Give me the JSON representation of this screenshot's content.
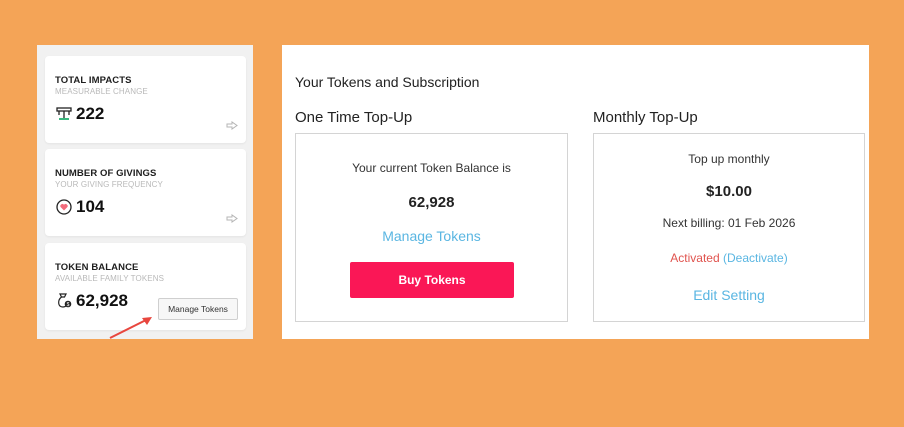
{
  "cards": {
    "impacts": {
      "title": "TOTAL IMPACTS",
      "subtitle": "MEASURABLE CHANGE",
      "value": "222",
      "icon": "impact-icon"
    },
    "givings": {
      "title": "NUMBER OF GIVINGS",
      "subtitle": "YOUR GIVING FREQUENCY",
      "value": "104",
      "icon": "heart-cycle-icon"
    },
    "tokens": {
      "title": "TOKEN BALANCE",
      "subtitle": "AVAILABLE FAMILY TOKENS",
      "value": "62,928",
      "icon": "money-bag-icon",
      "button_label": "Manage Tokens"
    }
  },
  "subscription": {
    "title": "Your Tokens and Subscription",
    "one_time": {
      "heading": "One Time Top-Up",
      "balance_label": "Your current Token Balance is",
      "balance": "62,928",
      "manage_link": "Manage Tokens",
      "buy_label": "Buy Tokens"
    },
    "monthly": {
      "heading": "Monthly Top-Up",
      "label": "Top up monthly",
      "price": "$10.00",
      "next_billing": "Next billing: 01 Feb 2026",
      "status": "Activated",
      "deactivate": "(Deactivate)",
      "edit_link": "Edit Setting"
    }
  },
  "colors": {
    "background": "#F4A457",
    "accent_pink": "#FA1756",
    "link_blue": "#5AB6E2",
    "status_red": "#E0534E",
    "annotation_arrow": "#E8463E"
  }
}
